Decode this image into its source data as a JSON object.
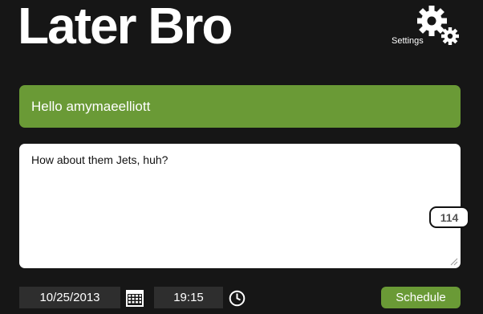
{
  "app": {
    "title": "Later Bro"
  },
  "settings": {
    "label": "Settings",
    "icon": "gear-icon"
  },
  "greeting": {
    "text": "Hello amymaeelliott"
  },
  "composer": {
    "message": "How about them Jets, huh?",
    "remaining_chars": "114"
  },
  "schedule": {
    "date_value": "10/25/2013",
    "date_icon": "calendar-icon",
    "time_value": "19:15",
    "time_icon": "clock-icon",
    "button_label": "Schedule"
  },
  "colors": {
    "background": "#161616",
    "accent": "#6a9a36",
    "field": "#2e2e2e"
  }
}
